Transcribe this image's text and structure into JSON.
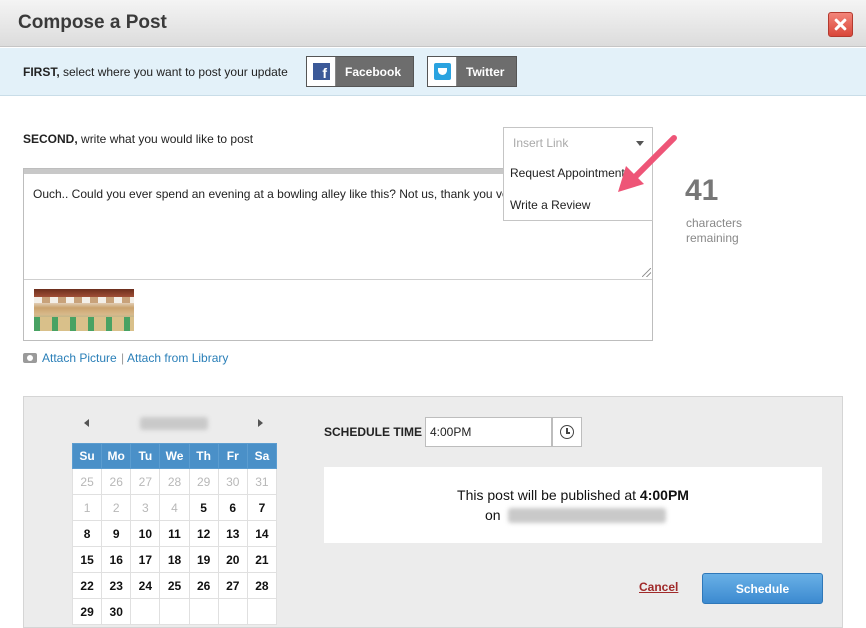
{
  "window": {
    "title": "Compose a Post"
  },
  "first": {
    "bold": "FIRST,",
    "text": " select where you want to post your update",
    "facebook_label": "Facebook",
    "twitter_label": "Twitter"
  },
  "second": {
    "bold": "SECOND,",
    "text": " write what you would like to post",
    "post_text": "Ouch.. Could you ever spend an evening at a bowling alley like this? Not us, thank you ve",
    "insert_link": {
      "placeholder": "Insert Link",
      "items": [
        "Request Appointment",
        "Write a Review"
      ]
    },
    "characters_remaining_count": "41",
    "characters_remaining_label": "characters remaining",
    "attach_picture": "Attach Picture",
    "attach_separator": "|",
    "attach_library": "Attach from Library"
  },
  "calendar": {
    "weekdays": [
      "Su",
      "Mo",
      "Tu",
      "We",
      "Th",
      "Fr",
      "Sa"
    ],
    "rows": [
      [
        {
          "d": "25",
          "m": true
        },
        {
          "d": "26",
          "m": true
        },
        {
          "d": "27",
          "m": true
        },
        {
          "d": "28",
          "m": true
        },
        {
          "d": "29",
          "m": true
        },
        {
          "d": "30",
          "m": true
        },
        {
          "d": "31",
          "m": true
        }
      ],
      [
        {
          "d": "1",
          "m": true
        },
        {
          "d": "2",
          "m": true
        },
        {
          "d": "3",
          "m": true
        },
        {
          "d": "4",
          "m": true
        },
        {
          "d": "5",
          "m": false
        },
        {
          "d": "6",
          "m": false
        },
        {
          "d": "7",
          "m": false
        }
      ],
      [
        {
          "d": "8",
          "m": false
        },
        {
          "d": "9",
          "m": false
        },
        {
          "d": "10",
          "m": false
        },
        {
          "d": "11",
          "m": false
        },
        {
          "d": "12",
          "m": false
        },
        {
          "d": "13",
          "m": false
        },
        {
          "d": "14",
          "m": false
        }
      ],
      [
        {
          "d": "15",
          "m": false
        },
        {
          "d": "16",
          "m": false
        },
        {
          "d": "17",
          "m": false
        },
        {
          "d": "18",
          "m": false
        },
        {
          "d": "19",
          "m": false
        },
        {
          "d": "20",
          "m": false
        },
        {
          "d": "21",
          "m": false
        }
      ],
      [
        {
          "d": "22",
          "m": false
        },
        {
          "d": "23",
          "m": false
        },
        {
          "d": "24",
          "m": false
        },
        {
          "d": "25",
          "m": false
        },
        {
          "d": "26",
          "m": false
        },
        {
          "d": "27",
          "m": false
        },
        {
          "d": "28",
          "m": false
        }
      ],
      [
        {
          "d": "29",
          "m": false
        },
        {
          "d": "30",
          "m": false
        },
        {
          "d": "",
          "m": false
        },
        {
          "d": "",
          "m": false
        },
        {
          "d": "",
          "m": false
        },
        {
          "d": "",
          "m": false
        },
        {
          "d": "",
          "m": false
        }
      ]
    ]
  },
  "schedule": {
    "label": "SCHEDULE TIME",
    "time_value": "4:00PM",
    "publish_prefix": "This post will be published at ",
    "publish_time": "4:00PM",
    "publish_on": "on",
    "cancel_label": "Cancel",
    "schedule_label": "Schedule"
  },
  "colors": {
    "accent_blue": "#4a90c8",
    "link_blue": "#2a7fb8",
    "cancel_red": "#a02a2a",
    "arrow_pink": "#ee5577"
  }
}
